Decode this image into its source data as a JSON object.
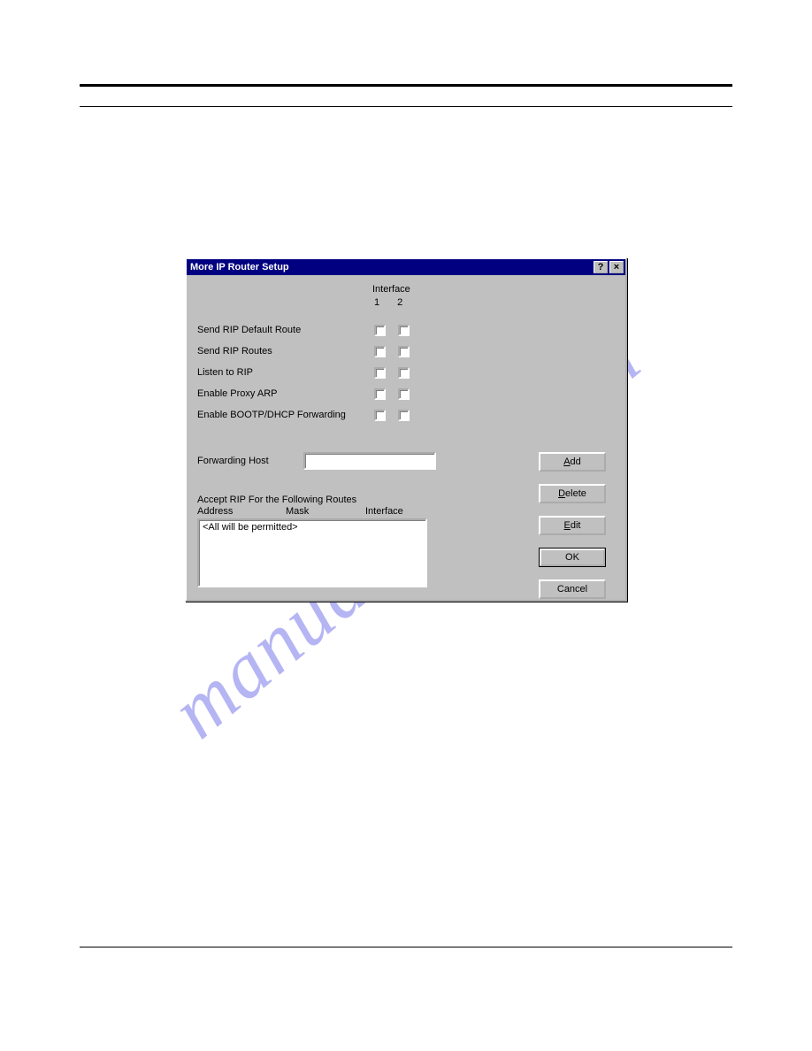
{
  "watermark": "manualshive.com",
  "dialog": {
    "title": "More IP Router Setup",
    "interface_header": "Interface",
    "interface_cols": [
      "1",
      "2"
    ],
    "options": [
      {
        "label": "Send RIP Default Route",
        "if1": false,
        "if2": false
      },
      {
        "label": "Send RIP Routes",
        "if1": false,
        "if2": false
      },
      {
        "label": "Listen to RIP",
        "if1": false,
        "if2": false
      },
      {
        "label": "Enable Proxy ARP",
        "if1": false,
        "if2": false
      },
      {
        "label": "Enable BOOTP/DHCP Forwarding",
        "if1": false,
        "if2": false
      }
    ],
    "forwarding_host_label": "Forwarding Host",
    "forwarding_host_value": "",
    "accept_section_label": "Accept RIP For the Following Routes",
    "columns": {
      "address": "Address",
      "mask": "Mask",
      "interface": "Interface"
    },
    "list_items": [
      "<All will be permitted>"
    ],
    "buttons": {
      "add": "Add",
      "delete": "Delete",
      "edit": "Edit",
      "ok": "OK",
      "cancel": "Cancel"
    }
  }
}
